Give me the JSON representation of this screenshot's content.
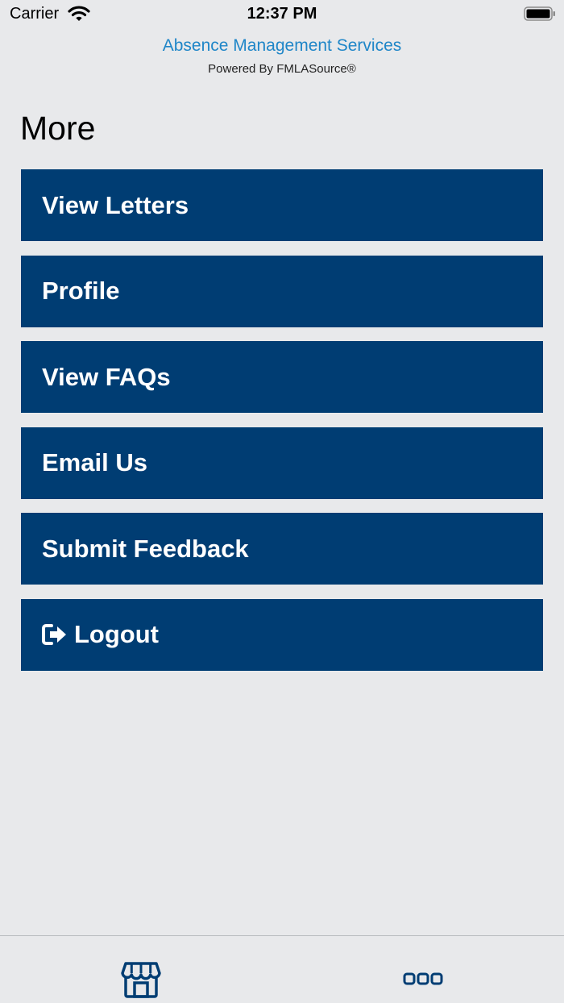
{
  "status_bar": {
    "carrier": "Carrier",
    "time": "12:37 PM",
    "icons": [
      "wifi-icon",
      "battery-icon"
    ]
  },
  "header": {
    "title": "Absence Management Services",
    "subtitle": "Powered By FMLASource®"
  },
  "page": {
    "title": "More"
  },
  "menu": {
    "items": [
      {
        "label": "View Letters"
      },
      {
        "label": "Profile"
      },
      {
        "label": "View FAQs"
      },
      {
        "label": "Email Us"
      },
      {
        "label": "Submit Feedback"
      },
      {
        "label": "Logout",
        "icon": "logout-icon"
      }
    ]
  },
  "tab_bar": {
    "tabs": [
      {
        "icon": "storefront-icon"
      },
      {
        "icon": "more-dots-icon"
      }
    ]
  },
  "colors": {
    "background": "#e8e9eb",
    "menu_button": "#003d73",
    "title_link": "#1f86c8"
  }
}
